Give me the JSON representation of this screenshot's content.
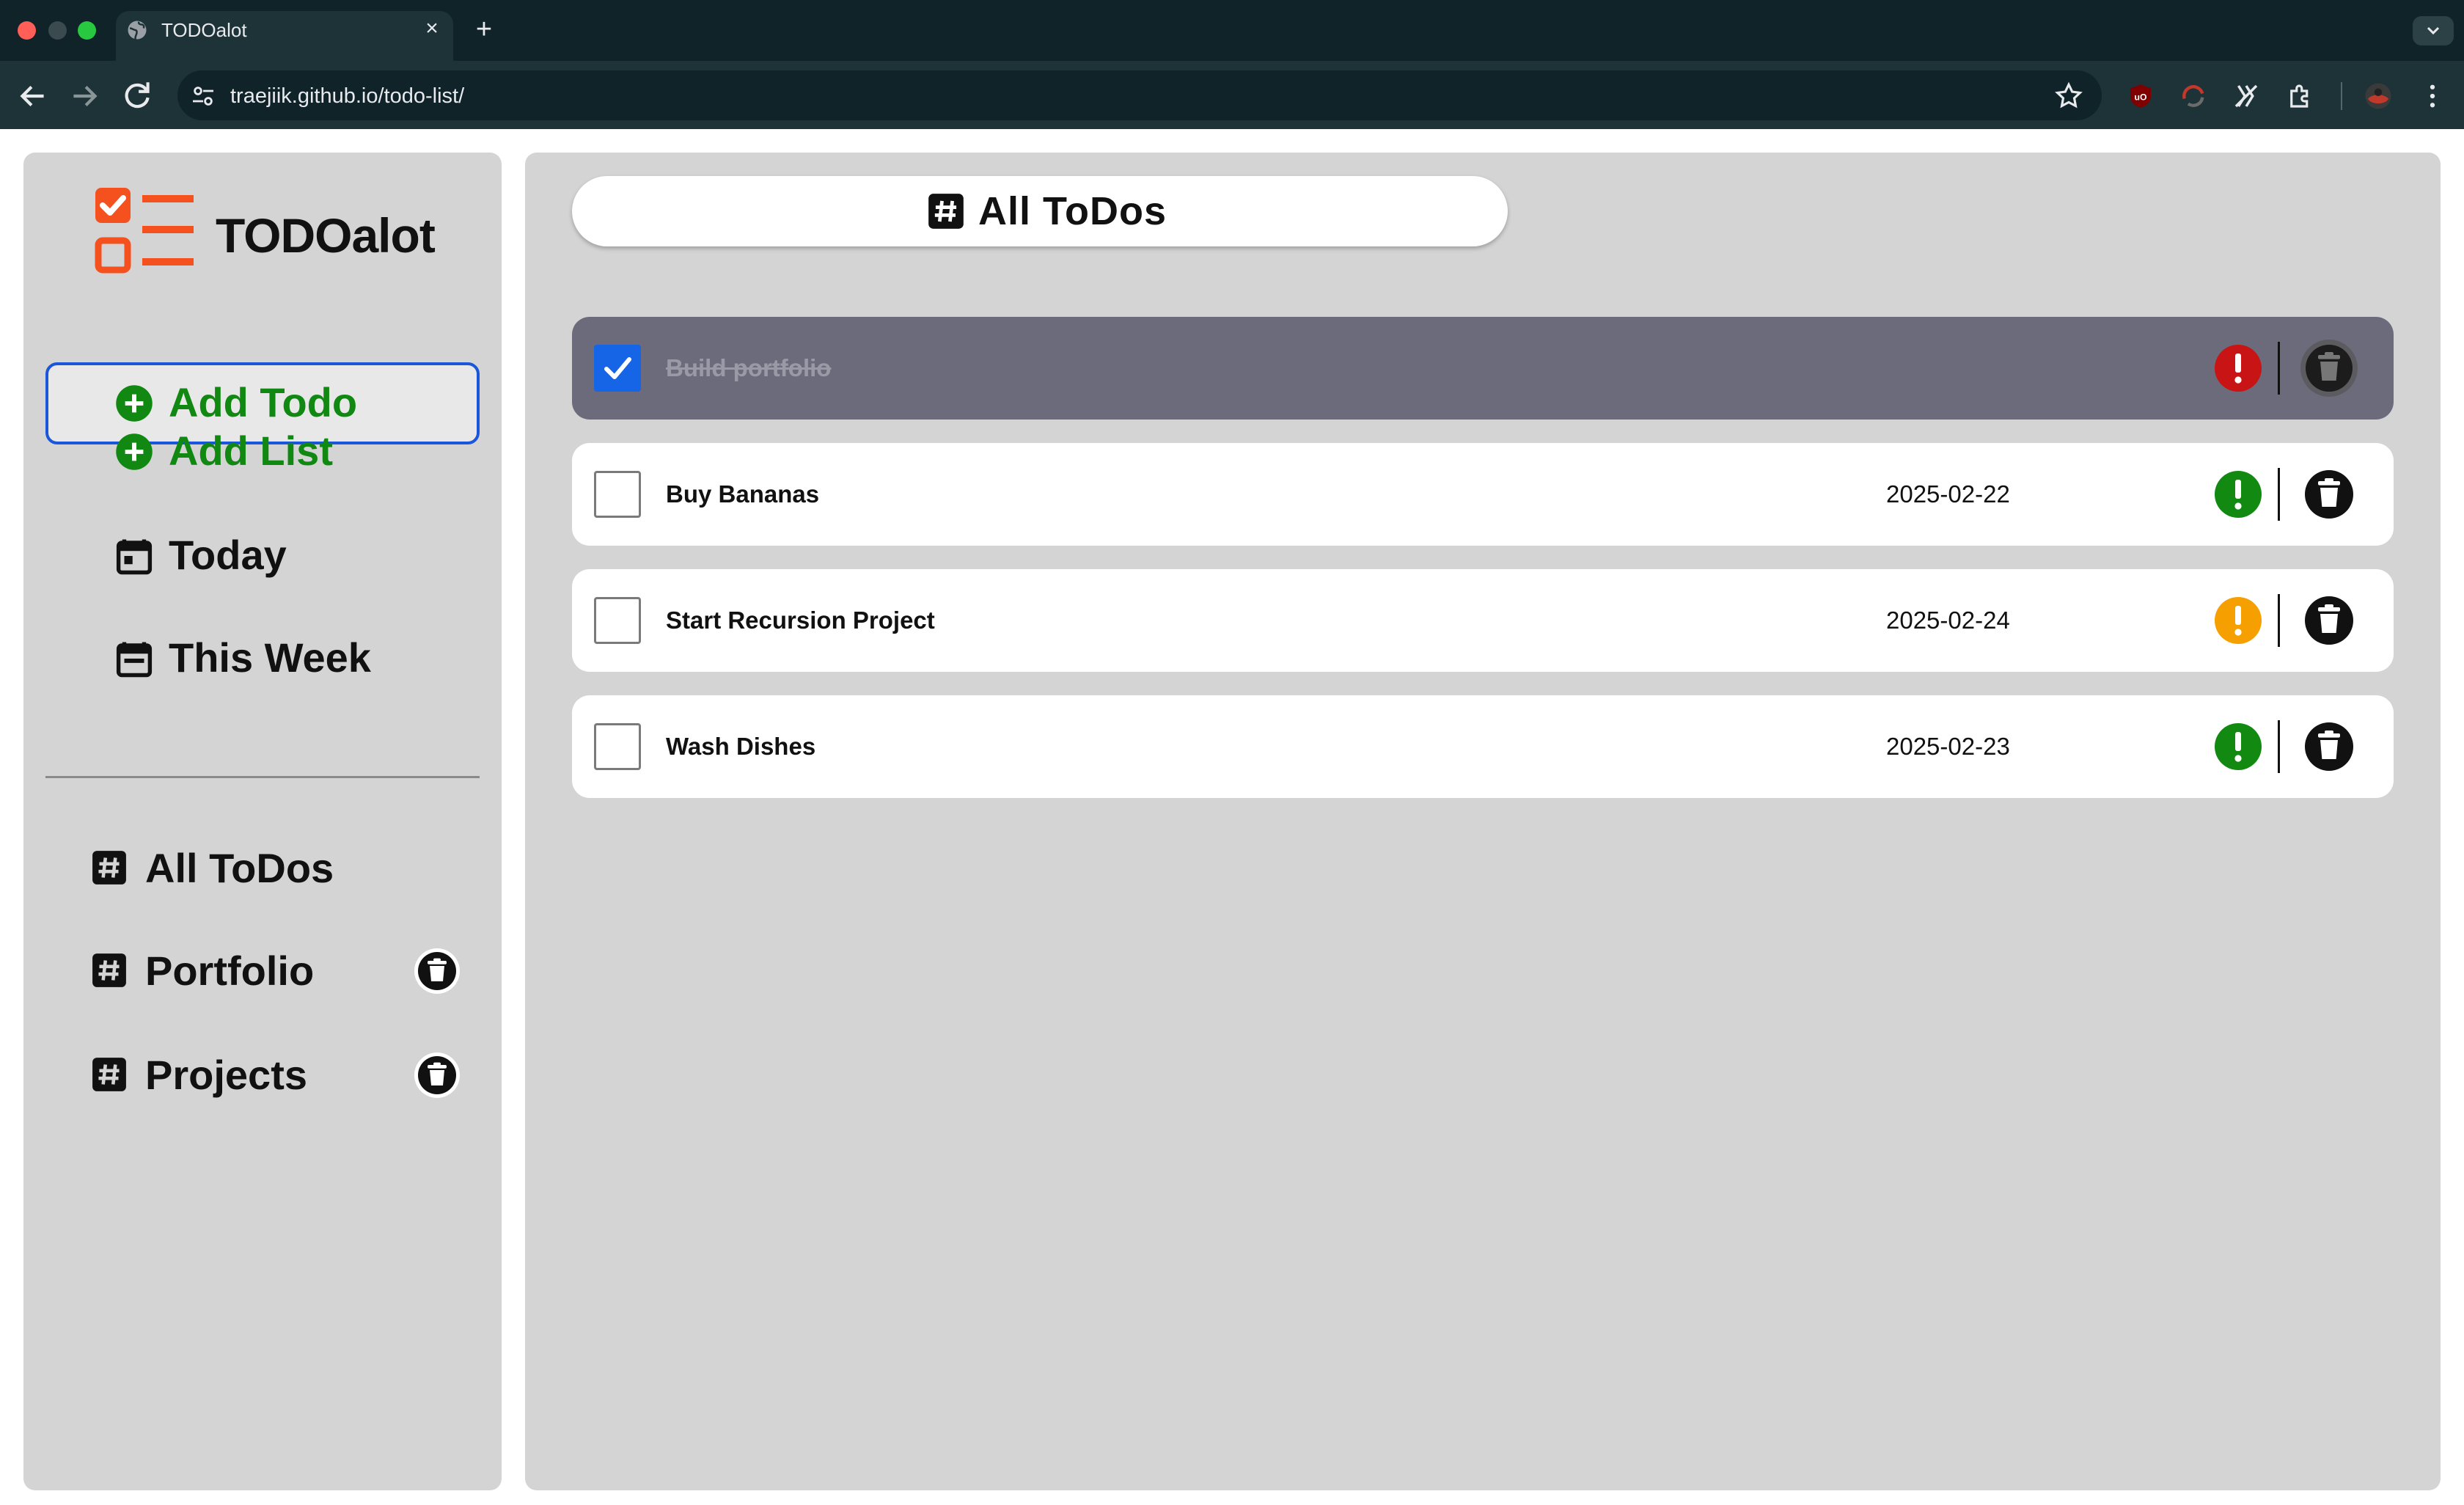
{
  "browser": {
    "tab_title": "TODOalot",
    "url": "traejiik.github.io/todo-list/",
    "close_glyph": "×",
    "new_tab_glyph": "+"
  },
  "sidebar": {
    "logo_text": "TODOalot",
    "actions": [
      {
        "label": "Add Todo",
        "icon": "plus-circle-icon"
      },
      {
        "label": "Add List",
        "icon": "plus-circle-icon"
      },
      {
        "label": "Today",
        "icon": "calendar-day-icon"
      },
      {
        "label": "This Week",
        "icon": "calendar-week-icon"
      }
    ],
    "lists": [
      {
        "label": "All ToDos",
        "deletable": false
      },
      {
        "label": "Portfolio",
        "deletable": true
      },
      {
        "label": "Projects",
        "deletable": true
      }
    ]
  },
  "main": {
    "list_title": "All ToDos",
    "todos": [
      {
        "title": "Build portfolio",
        "due": "",
        "completed": true,
        "priority": "high",
        "priority_color": "#c81414"
      },
      {
        "title": "Buy Bananas",
        "due": "2025-02-22",
        "completed": false,
        "priority": "low",
        "priority_color": "#128a12"
      },
      {
        "title": "Start Recursion Project",
        "due": "2025-02-24",
        "completed": false,
        "priority": "medium",
        "priority_color": "#f5a000"
      },
      {
        "title": "Wash Dishes",
        "due": "2025-02-23",
        "completed": false,
        "priority": "low",
        "priority_color": "#128a12"
      }
    ]
  },
  "colors": {
    "accent_green": "#118811",
    "logo_orange": "#f4511e",
    "checkbox_blue": "#1565e6",
    "panel_gray": "#d4d4d4",
    "completed_row": "#6b6b7b"
  }
}
